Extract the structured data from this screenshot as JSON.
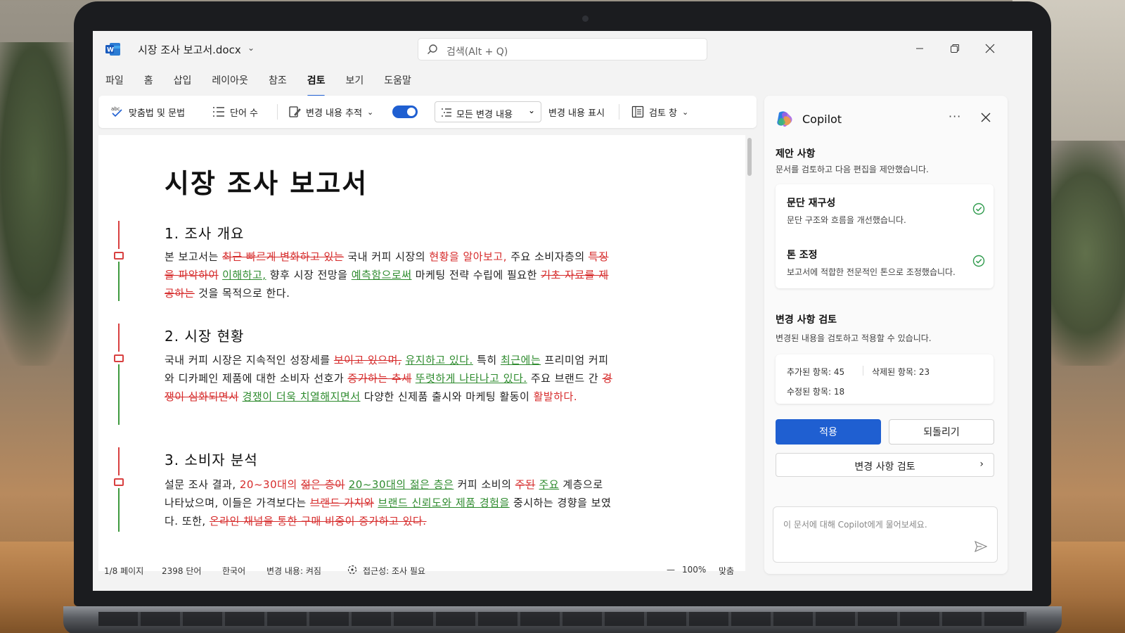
{
  "window": {
    "title": "시장 조사 보고서.docx",
    "search_placeholder": "검색(Alt + Q)"
  },
  "ribbon": {
    "tabs": [
      "파일",
      "홈",
      "삽입",
      "레이아웃",
      "참조",
      "검토",
      "보기",
      "도움말"
    ],
    "active_tab": "검토"
  },
  "toolbar": {
    "spelling": "맞춤법 및 문법",
    "word_count": "단어 수",
    "track_changes": "변경 내용 추적",
    "track_changes_on": true,
    "markup_select": "모든 변경 내용",
    "show_markup": "변경 내용 표시",
    "review_pane": "검토 창"
  },
  "document": {
    "title": "시장 조사 보고서",
    "sections": [
      {
        "heading": "1. 조사 개요",
        "runs": [
          {
            "t": "본 보고서는 ",
            "k": "n"
          },
          {
            "t": "최근 빠르게 변화하고 있는",
            "k": "d"
          },
          {
            "t": " 국내 커피 시장의 ",
            "k": "n"
          },
          {
            "t": "현황을 알아보고,",
            "k": "r"
          },
          {
            "t": " 주요 소비자층의 ",
            "k": "n"
          },
          {
            "t": "특징을 파악하여",
            "k": "d"
          },
          {
            "t": " ",
            "k": "n"
          },
          {
            "t": "이해하고,",
            "k": "i"
          },
          {
            "t": " 향후 시장 전망을 ",
            "k": "n"
          },
          {
            "t": "예측함으로써",
            "k": "i"
          },
          {
            "t": " 마케팅 전략 수립에 필요한 ",
            "k": "n"
          },
          {
            "t": "기초 자료를 제공하는",
            "k": "d"
          },
          {
            "t": " 것을 목적으로 한다.",
            "k": "n"
          }
        ]
      },
      {
        "heading": "2. 시장 현황",
        "runs": [
          {
            "t": "국내 커피 시장은 지속적인 성장세를 ",
            "k": "n"
          },
          {
            "t": "보이고 있으며,",
            "k": "d"
          },
          {
            "t": " ",
            "k": "n"
          },
          {
            "t": "유지하고 있다.",
            "k": "i"
          },
          {
            "t": " 특히 ",
            "k": "n"
          },
          {
            "t": "최근에는",
            "k": "i"
          },
          {
            "t": " 프리미엄 커피와 디카페인 제품에 대한 소비자 선호가 ",
            "k": "n"
          },
          {
            "t": "증가하는 추세",
            "k": "d"
          },
          {
            "t": " ",
            "k": "n"
          },
          {
            "t": "뚜렷하게 나타나고 있다.",
            "k": "i"
          },
          {
            "t": " 주요 브랜드 간 ",
            "k": "n"
          },
          {
            "t": "경쟁이 심화되면서",
            "k": "d"
          },
          {
            "t": " ",
            "k": "n"
          },
          {
            "t": "경쟁이 더욱 치열해지면서",
            "k": "i"
          },
          {
            "t": " 다양한 신제품 출시와 마케팅 활동이 ",
            "k": "n"
          },
          {
            "t": "활발하다.",
            "k": "r"
          }
        ]
      },
      {
        "heading": "3. 소비자 분석",
        "runs": [
          {
            "t": "설문 조사 결과, ",
            "k": "n"
          },
          {
            "t": "20~30대의",
            "k": "r"
          },
          {
            "t": " ",
            "k": "n"
          },
          {
            "t": "젊은 층이",
            "k": "d"
          },
          {
            "t": " ",
            "k": "n"
          },
          {
            "t": "20~30대의 젊은 층은",
            "k": "i"
          },
          {
            "t": " 커피 소비의 ",
            "k": "n"
          },
          {
            "t": "주된",
            "k": "d"
          },
          {
            "t": " ",
            "k": "n"
          },
          {
            "t": "주요",
            "k": "i"
          },
          {
            "t": " 계층으로 나타났으며, 이들은 가격보다는 ",
            "k": "n"
          },
          {
            "t": "브랜드 가치와",
            "k": "d"
          },
          {
            "t": " ",
            "k": "n"
          },
          {
            "t": "브랜드 신뢰도와 제품 경험을",
            "k": "i"
          },
          {
            "t": " 중시하는 경향을 보였다. 또한, ",
            "k": "n"
          },
          {
            "t": "온라인 채널을 통한 구매 비중이 증가하고 있다.",
            "k": "d"
          }
        ]
      }
    ]
  },
  "statusbar": {
    "page": "1/8 페이지",
    "words": "2398 단어",
    "language": "한국어",
    "track_status": "변경 내용: 켜짐",
    "accessibility": "접근성: 조사 필요",
    "zoom_minus": "—",
    "zoom": "100%",
    "fit": "맞춤"
  },
  "copilot": {
    "title": "Copilot",
    "more": "···",
    "suggestions_heading": "제안 사항",
    "suggestions_sub": "문서를 검토하고 다음 편집을 제안했습니다.",
    "suggestions": [
      {
        "title": "문단 재구성",
        "desc": "문단 구조와 흐름을 개선했습니다."
      },
      {
        "title": "톤 조정",
        "desc": "보고서에 적합한 전문적인 톤으로 조정했습니다."
      }
    ],
    "review_heading": "변경 사항 검토",
    "review_sub": "변경된 내용을 검토하고 적용할 수 있습니다.",
    "stats": {
      "added": "추가된 항목: 45",
      "deleted": "삭제된 항목: 23",
      "modified": "수정된 항목: 18"
    },
    "apply": "적용",
    "revert": "되돌리기",
    "review_button": "변경 사항 검토",
    "chat_placeholder": "이 문서에 대해 Copilot에게 물어보세요."
  },
  "colors": {
    "accent": "#1f5fd1",
    "deleted": "#d62b2b",
    "inserted": "#2e8b2e",
    "check": "#2e9a4c"
  }
}
